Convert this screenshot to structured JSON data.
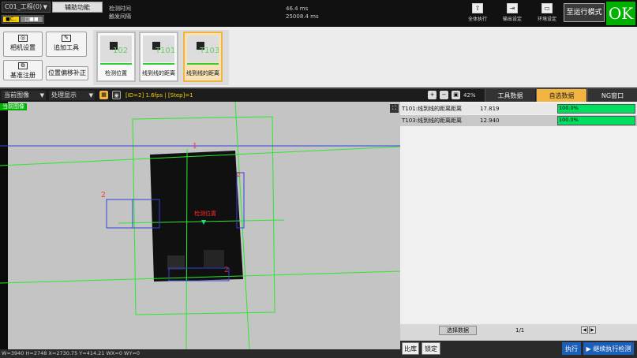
{
  "topbar": {
    "scene": "C01_工程(0)",
    "assist": "辅助功能",
    "mini_yellow": "■C..",
    "mini_gray": "□■■",
    "timing_labels": [
      "检测时间",
      "触发间隔"
    ],
    "timing_values": [
      "46.4 ms",
      "25008.4 ms"
    ],
    "buttons": [
      "全体执行",
      "输出设定",
      "环境设定"
    ],
    "icons": [
      "play-all-icon",
      "output-icon",
      "monitor-icon"
    ],
    "run_mode": "至运行模式",
    "judgment": "OK"
  },
  "tools": {
    "left_buttons": [
      "相机设置",
      "追加工具",
      "基准注册",
      "位置偏移补正"
    ],
    "flow": [
      {
        "label": "检测位置",
        "num": "102"
      },
      {
        "label": "线到线的距离",
        "num": "T101"
      },
      {
        "label": "线到线的距离",
        "num": "T103"
      }
    ]
  },
  "toolbar2": {
    "view_select": "当前图像",
    "display_select": "处理显示",
    "info": "[ID=2] 1.6fps | [Step]=1",
    "zoom": "42%",
    "tabs": [
      "工具数据",
      "自选数据",
      "NG窗口"
    ]
  },
  "image": {
    "current_label": "当前图像",
    "marks": [
      "1",
      "2",
      "2",
      "2",
      "检测位置"
    ]
  },
  "status": "W=3940 H=2748 X=2730.75 Y=414.21 WX=0 WY=0",
  "results": {
    "rows": [
      {
        "name": "T101:线到线的距离距离",
        "value": "17.819",
        "pct": "100.0%"
      },
      {
        "name": "T103:线到线的距离距离",
        "value": "12.940",
        "pct": "100.0%"
      }
    ],
    "select_button": "选择数据",
    "page": "1/1"
  },
  "footer": {
    "buttons": [
      "比库",
      "锁定",
      "执行",
      "继续执行检测"
    ]
  }
}
